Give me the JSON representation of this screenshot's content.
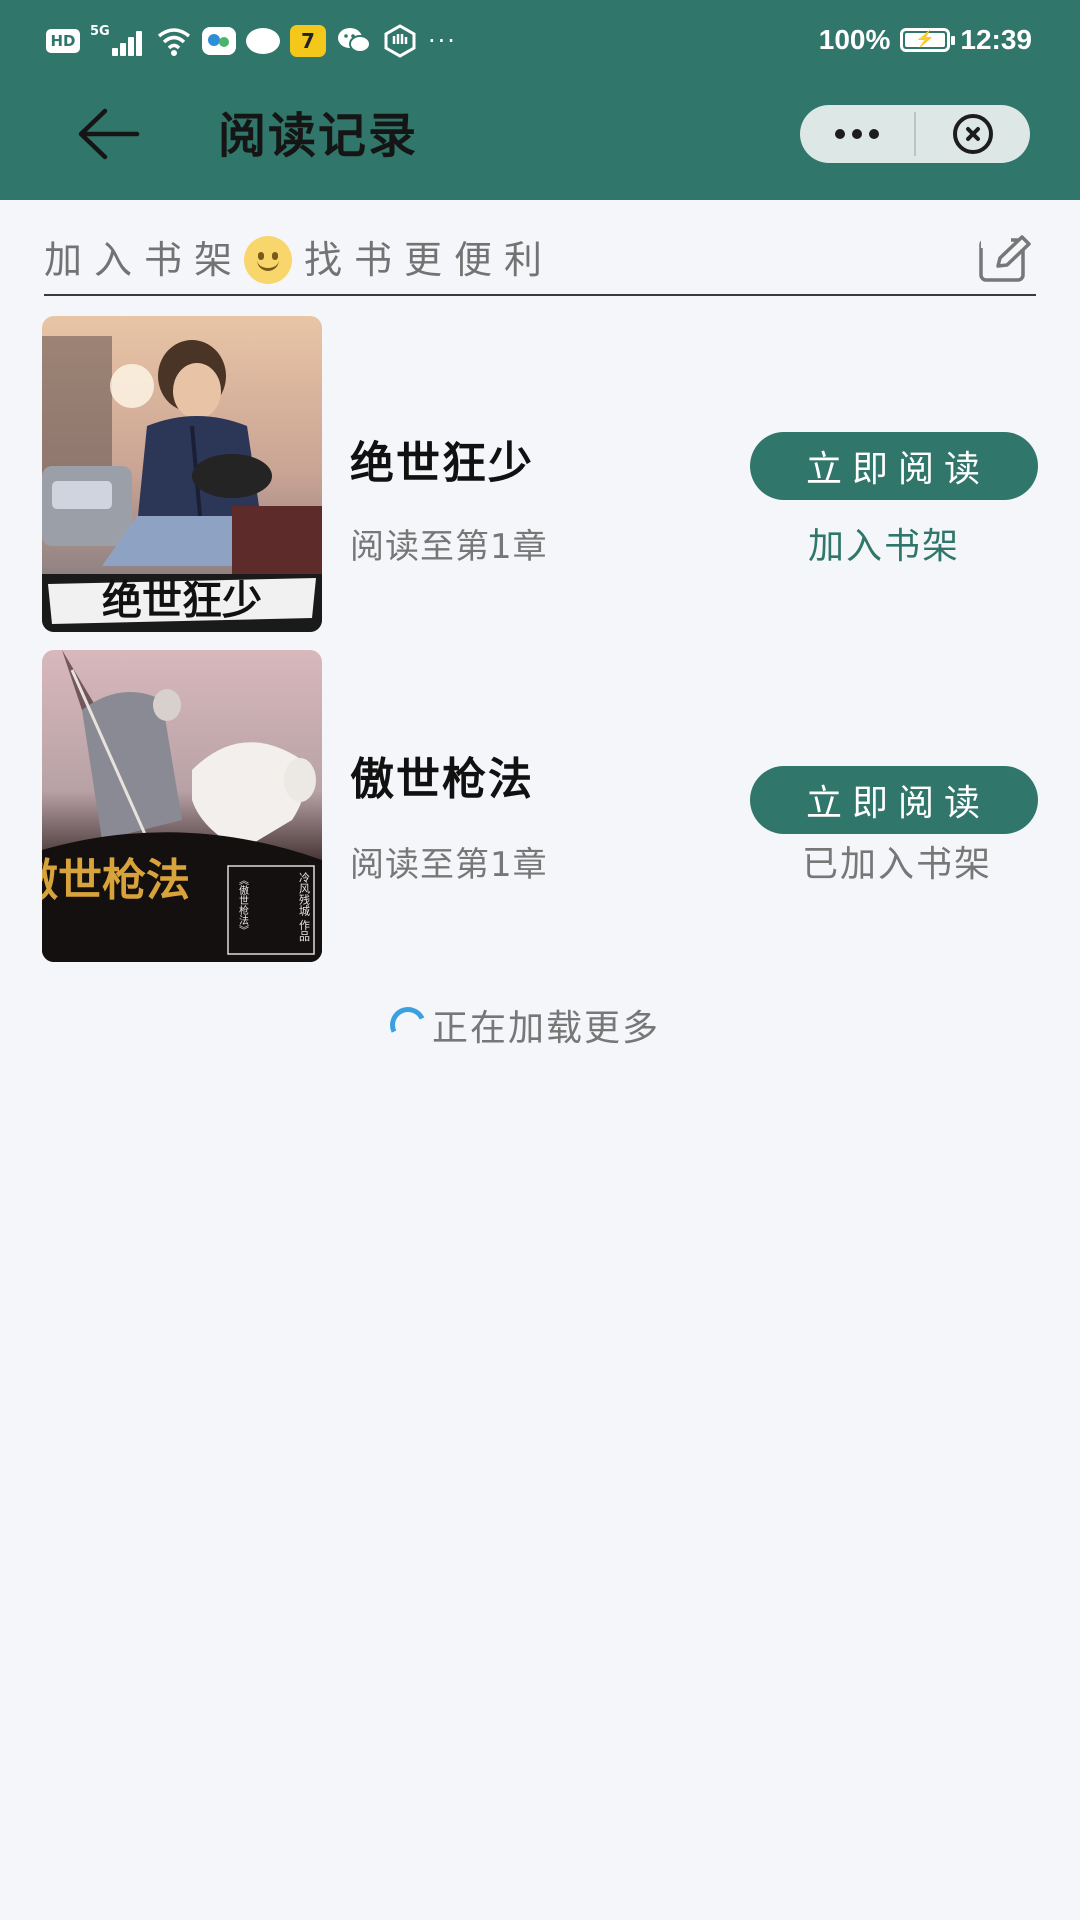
{
  "status_bar": {
    "hd": "HD",
    "network": "5G",
    "yellow_app_glyph": "7",
    "more": "···",
    "battery_percent": "100%",
    "time": "12:39",
    "icons": [
      "hd-icon",
      "signal-5g-icon",
      "wifi-icon",
      "message-app-icon",
      "chat-icon",
      "yellow-app-icon",
      "wechat-icon",
      "hand-icon",
      "more-notifications-icon",
      "battery-charging-icon"
    ]
  },
  "nav": {
    "title": "阅读记录",
    "back_icon": "back-arrow-icon",
    "capsule_icons": [
      "more-dots-icon",
      "close-circle-icon"
    ]
  },
  "hint": {
    "text_before": "加入书架",
    "text_after": "找书更便利",
    "emoji": "smiley-icon",
    "edit_icon": "edit-icon"
  },
  "books": [
    {
      "title": "绝世狂少",
      "progress": "阅读至第1章",
      "read_label": "立即阅读",
      "shelf_label": "加入书架",
      "shelf_state": "add",
      "cover_text": "绝世狂少"
    },
    {
      "title": "傲世枪法",
      "progress": "阅读至第1章",
      "read_label": "立即阅读",
      "shelf_label": "已加入书架",
      "shelf_state": "added",
      "cover_text": "傲世枪法",
      "cover_subtext": "冷风残城 作品",
      "cover_book_name": "《傲世枪法》"
    }
  ],
  "loading": {
    "text": "正在加载更多"
  },
  "colors": {
    "header_bg": "#31766a",
    "page_bg": "#f4f6fa",
    "button_bg": "#31766a",
    "shelf_link": "#31766a",
    "spinner": "#3aa0e0"
  }
}
